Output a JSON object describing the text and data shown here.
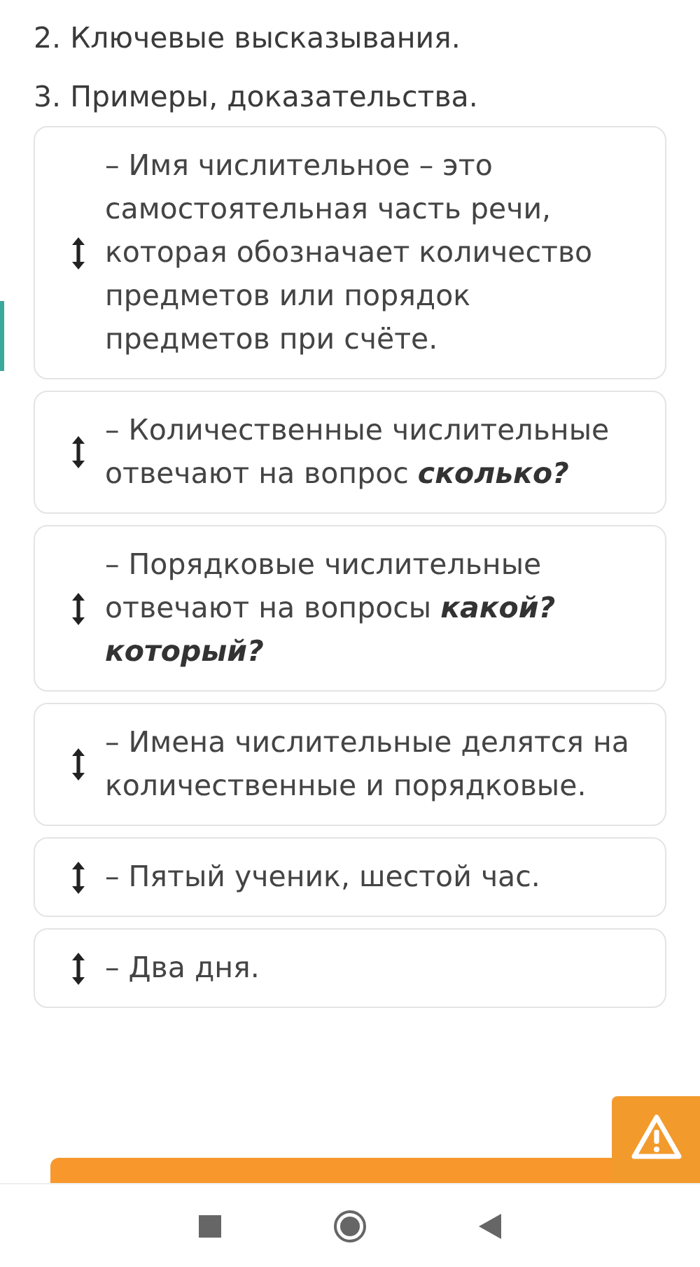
{
  "headings": [
    "2. Ключевые высказывания.",
    "3. Примеры, доказательства."
  ],
  "items": [
    {
      "text": "– Имя числительное – это самостоятельная часть речи, которая обозначает количество предметов или порядок предметов при счёте."
    },
    {
      "text": "– Количественные числительные отвечают на вопрос **сколько?**"
    },
    {
      "text": "– Порядковые числительные отвечают на вопросы **какой? который?**"
    },
    {
      "text": "– Имена числительные делятся на количественные и порядковые."
    },
    {
      "text": "– Пятый ученик, шестой час."
    },
    {
      "text": "– Два дня."
    }
  ]
}
